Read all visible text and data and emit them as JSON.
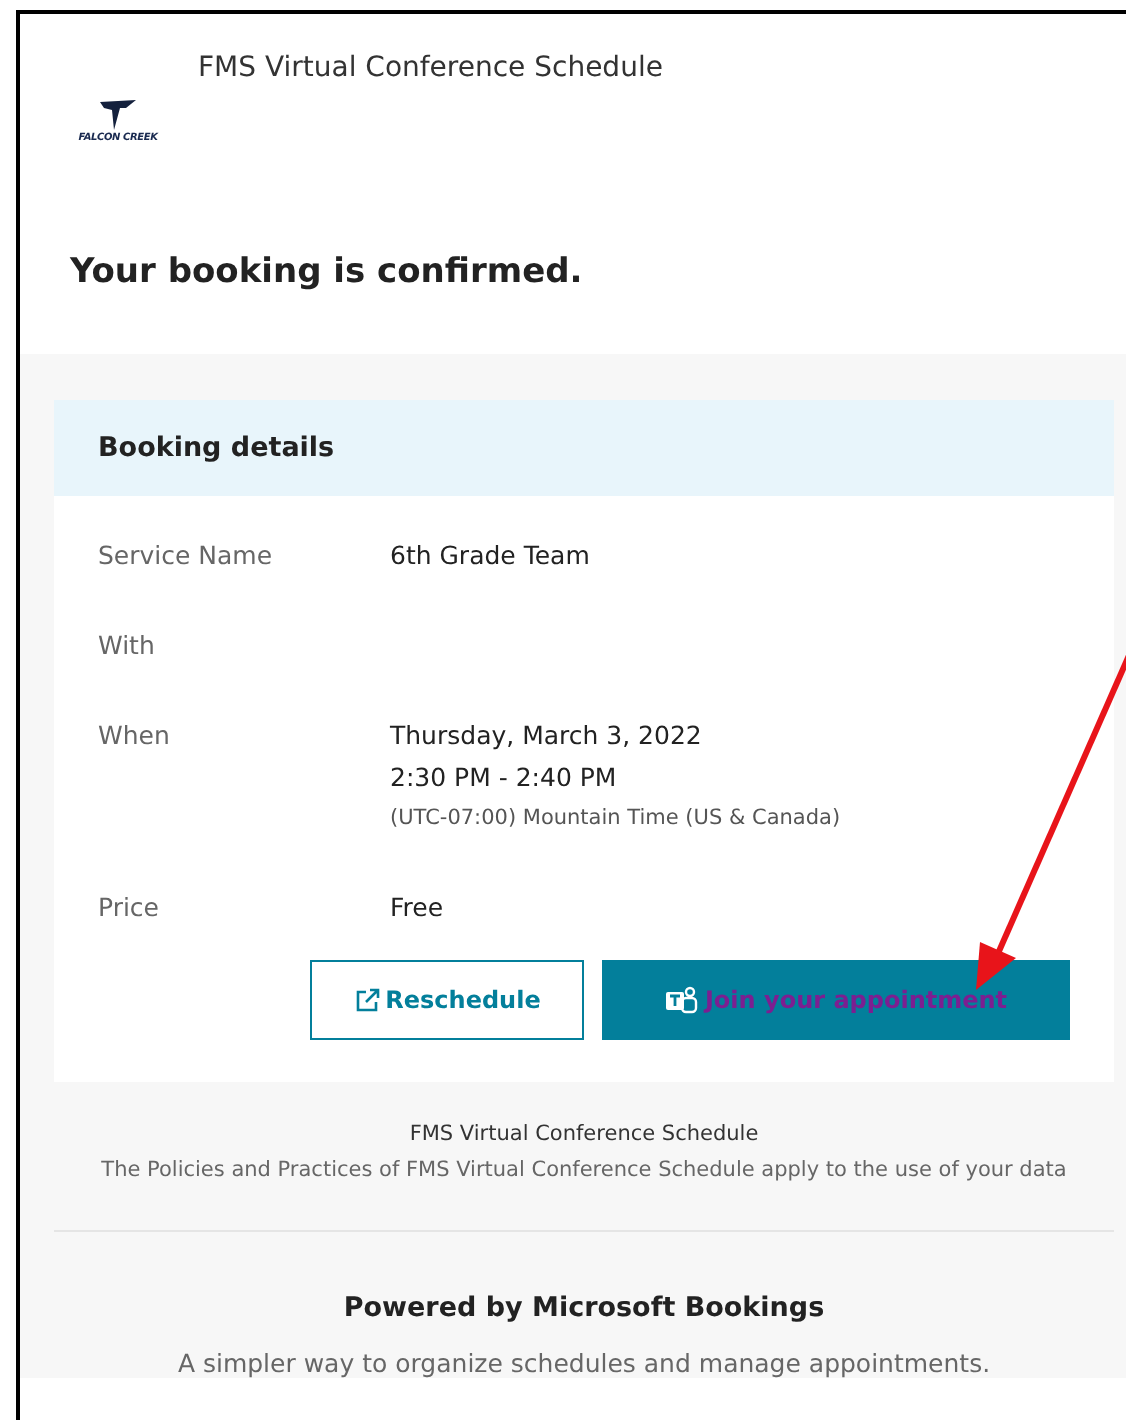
{
  "header": {
    "logo_text": "FALCON CREEK",
    "title": "FMS Virtual Conference Schedule"
  },
  "heading": "Your booking is confirmed.",
  "booking_details": {
    "title": "Booking details",
    "rows": [
      {
        "label": "Service Name",
        "lines": [
          {
            "kind": "main",
            "text": "6th Grade Team"
          }
        ]
      },
      {
        "label": "With",
        "lines": []
      },
      {
        "label": "When",
        "lines": [
          {
            "kind": "main",
            "text": "Thursday, March 3, 2022"
          },
          {
            "kind": "main",
            "text": "2:30 PM - 2:40 PM"
          },
          {
            "kind": "note",
            "text": "(UTC-07:00) Mountain Time (US & Canada)"
          }
        ]
      },
      {
        "label": "Price",
        "lines": [
          {
            "kind": "main",
            "text": "Free"
          }
        ]
      }
    ],
    "buttons": [
      {
        "kind": "outline",
        "label": "Reschedule"
      },
      {
        "kind": "primary",
        "label": "Join your appointment"
      }
    ]
  },
  "footer": {
    "business": "FMS Virtual Conference Schedule",
    "policy": "The Policies and Practices of FMS Virtual Conference Schedule apply to the use of your data"
  },
  "powered": {
    "title": "Powered by Microsoft Bookings",
    "subtitle": "A simpler way to organize schedules and manage appointments."
  }
}
